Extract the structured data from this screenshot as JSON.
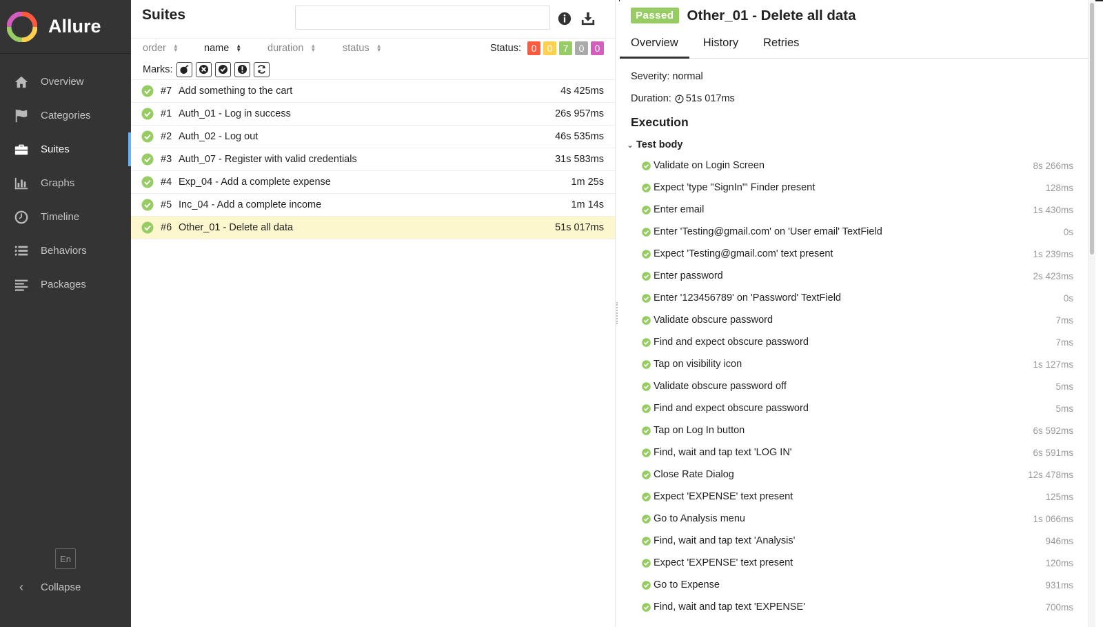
{
  "app": {
    "name": "Allure"
  },
  "sidebar": {
    "items": [
      {
        "label": "Overview",
        "icon": "home-icon"
      },
      {
        "label": "Categories",
        "icon": "flag-icon"
      },
      {
        "label": "Suites",
        "icon": "briefcase-icon",
        "active": true
      },
      {
        "label": "Graphs",
        "icon": "bar-chart-icon"
      },
      {
        "label": "Timeline",
        "icon": "clock-icon"
      },
      {
        "label": "Behaviors",
        "icon": "list-icon"
      },
      {
        "label": "Packages",
        "icon": "align-left-icon"
      }
    ],
    "language": "En",
    "collapse_label": "Collapse"
  },
  "suites": {
    "title": "Suites",
    "search_value": "",
    "sort": {
      "order": "order",
      "name": "name",
      "duration": "duration",
      "status": "status"
    },
    "status_label": "Status:",
    "status_counts": [
      {
        "value": "0",
        "color": "#fd5a3e"
      },
      {
        "value": "0",
        "color": "#ffd050"
      },
      {
        "value": "7",
        "color": "#97cc64"
      },
      {
        "value": "0",
        "color": "#aaaaaa"
      },
      {
        "value": "0",
        "color": "#d35ebe"
      }
    ],
    "marks_label": "Marks:",
    "tests": [
      {
        "id": "#7",
        "name": "Add something to the cart",
        "duration": "4s 425ms"
      },
      {
        "id": "#1",
        "name": "Auth_01 - Log in success",
        "duration": "26s 957ms"
      },
      {
        "id": "#2",
        "name": "Auth_02 - Log out",
        "duration": "46s 535ms"
      },
      {
        "id": "#3",
        "name": "Auth_07 - Register with valid credentials",
        "duration": "31s 583ms"
      },
      {
        "id": "#4",
        "name": "Exp_04 - Add a complete expense",
        "duration": "1m 25s"
      },
      {
        "id": "#5",
        "name": "Inc_04 - Add a complete income",
        "duration": "1m 14s"
      },
      {
        "id": "#6",
        "name": "Other_01 - Delete all data",
        "duration": "51s 017ms",
        "selected": true
      }
    ]
  },
  "detail": {
    "status_badge": "Passed",
    "title": "Other_01 - Delete all data",
    "tabs": [
      "Overview",
      "History",
      "Retries"
    ],
    "severity": "Severity: normal",
    "duration_label": "Duration:",
    "duration_value": "51s 017ms",
    "execution_title": "Execution",
    "test_body_label": "Test body",
    "steps": [
      {
        "name": "Validate on Login Screen",
        "duration": "8s 266ms"
      },
      {
        "name": "Expect 'type \"SignIn\"' Finder present",
        "duration": "128ms"
      },
      {
        "name": "Enter email",
        "duration": "1s 430ms"
      },
      {
        "name": "Enter 'Testing@gmail.com' on 'User email' TextField",
        "duration": "0s"
      },
      {
        "name": "Expect 'Testing@gmail.com' text present",
        "duration": "1s 239ms"
      },
      {
        "name": "Enter password",
        "duration": "2s 423ms"
      },
      {
        "name": "Enter '123456789' on 'Password' TextField",
        "duration": "0s"
      },
      {
        "name": "Validate obscure password",
        "duration": "7ms"
      },
      {
        "name": "Find and expect obscure password",
        "duration": "7ms"
      },
      {
        "name": "Tap on visibility icon",
        "duration": "1s 127ms"
      },
      {
        "name": "Validate obscure password off",
        "duration": "5ms"
      },
      {
        "name": "Find and expect obscure password",
        "duration": "5ms"
      },
      {
        "name": "Tap on Log In button",
        "duration": "6s 592ms"
      },
      {
        "name": "Find, wait and tap text 'LOG IN'",
        "duration": "6s 591ms"
      },
      {
        "name": "Close Rate Dialog",
        "duration": "12s 478ms"
      },
      {
        "name": "Expect 'EXPENSE' text present",
        "duration": "125ms"
      },
      {
        "name": "Go to Analysis menu",
        "duration": "1s 066ms"
      },
      {
        "name": "Find, wait and tap text 'Analysis'",
        "duration": "946ms"
      },
      {
        "name": "Expect 'EXPENSE' text present",
        "duration": "120ms"
      },
      {
        "name": "Go to Expense",
        "duration": "931ms"
      },
      {
        "name": "Find, wait and tap text 'EXPENSE'",
        "duration": "700ms"
      }
    ]
  },
  "colors": {
    "passed": "#97cc64",
    "sidebar_bg": "#343434",
    "active_indicator": "#6cb0f2",
    "selected_row": "#fcf7cc"
  }
}
